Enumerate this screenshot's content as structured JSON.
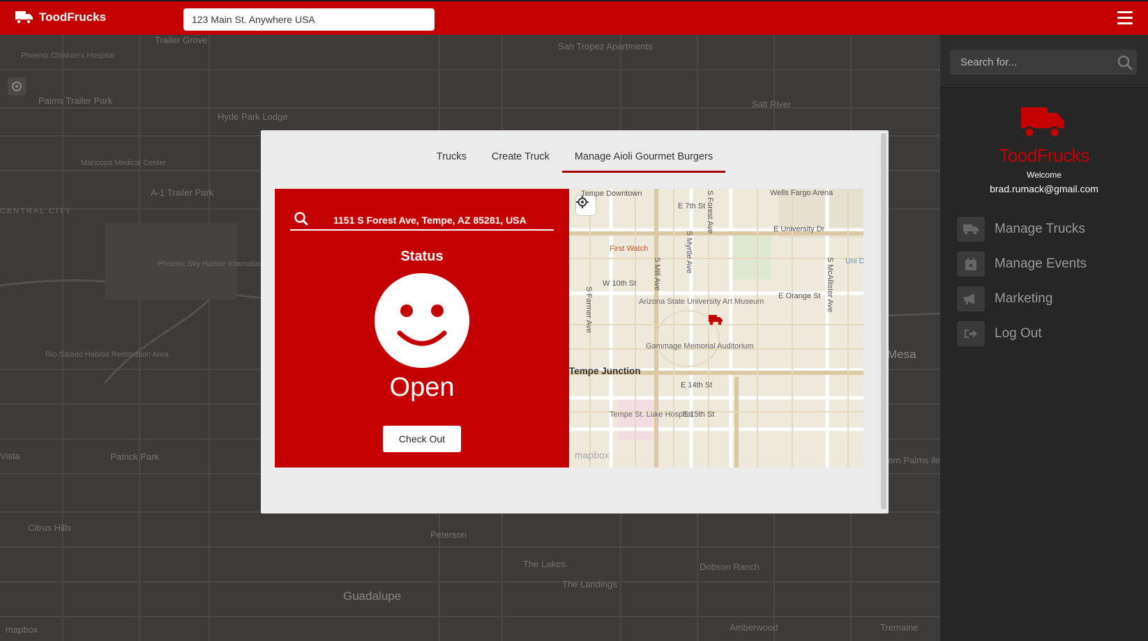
{
  "topbar": {
    "brand": "ToodFrucks",
    "address_value": "123 Main St. Anywhere USA"
  },
  "background_map": {
    "labels": [
      "Trailer Grove",
      "Phoenix Children's Hospital",
      "Palms Trailer Park",
      "Hyde Park Lodge",
      "Maricopa Medical Center",
      "A-1 Trailer Park",
      "CENTRAL CITY",
      "Phoenix Sky Harbor International Airport",
      "Rio Salado Habitat Restoration Area",
      "Patrick Park",
      "Citrus Hills",
      "Peterson",
      "Guadalupe",
      "The Lakes",
      "The Landings",
      "Dobson Ranch",
      "Amberwood",
      "Tremaine",
      "San Tropez Apartments",
      "Salt River",
      "Mesa",
      "Vista",
      "ern Palms iler Park"
    ],
    "attribution": "mapbox"
  },
  "sidebar": {
    "search_placeholder": "Search for...",
    "brand": "ToodFrucks",
    "welcome": "Welcome",
    "email": "brad.rumack@gmail.com",
    "menu": [
      {
        "label": "Manage Trucks",
        "icon": "truck-icon"
      },
      {
        "label": "Manage Events",
        "icon": "calendar-icon"
      },
      {
        "label": "Marketing",
        "icon": "megaphone-icon"
      },
      {
        "label": "Log Out",
        "icon": "logout-icon"
      }
    ]
  },
  "modal": {
    "tabs": [
      {
        "label": "Trucks",
        "active": false
      },
      {
        "label": "Create Truck",
        "active": false
      },
      {
        "label": "Manage Aioli Gourmet Burgers",
        "active": true
      }
    ],
    "location": "1151 S Forest Ave, Tempe, AZ 85281, USA",
    "status_title": "Status",
    "status_value": "Open",
    "checkout_label": "Check Out",
    "map": {
      "labels": {
        "tempe_downtown": "Tempe Downtown",
        "wells_fargo": "Wells Fargo Arena",
        "e7th": "E 7th St",
        "forest_ave": "S Forest Ave",
        "e_university": "E University Dr",
        "first_watch": "First Watch",
        "myrtle": "S Myrtle Ave",
        "mill": "S Mill Ave",
        "w10th": "W 10th St",
        "farmer": "S Farmer Ave",
        "asu_art": "Arizona State University Art Museum",
        "e_orange": "E Orange St",
        "mcallister": "S McAllister Ave",
        "gammage": "Gammage Memorial Auditorium",
        "tempe_junction": "Tempe Junction",
        "e14th": "E 14th St",
        "e15th": "E 15th St",
        "st_luke": "Tempe St. Luke Hospital",
        "uni": "Uni Dr / I",
        "attribution": "mapbox"
      }
    }
  },
  "colors": {
    "brand_red": "#c40000",
    "sidebar_bg": "#262626"
  }
}
